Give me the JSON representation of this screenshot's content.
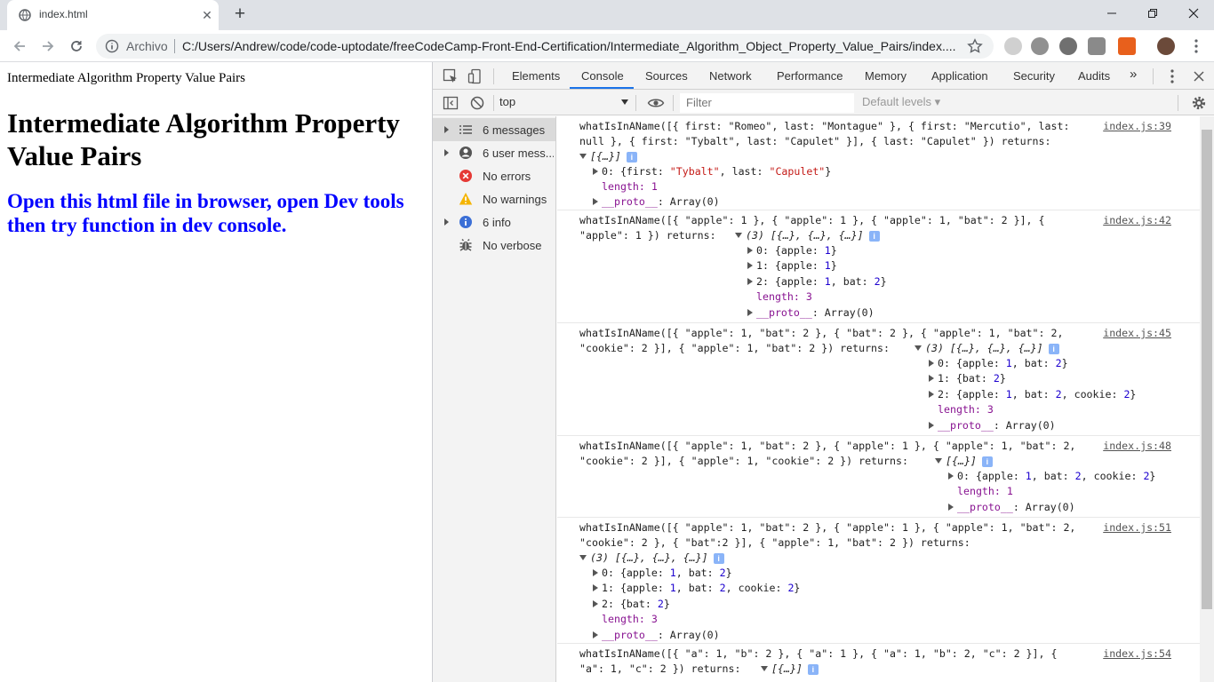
{
  "browser": {
    "tab_title": "index.html",
    "omnibox_label": "Archivo",
    "url": "C:/Users/Andrew/code/code-uptodate/freeCodeCamp-Front-End-Certification/Intermediate_Algorithm_Object_Property_Value_Pairs/index...."
  },
  "page": {
    "small_title": "Intermediate Algorithm Property Value Pairs",
    "heading": "Intermediate Algorithm Property Value Pairs",
    "subheading": "Open this html file in browser, open Dev tools then try function in dev console."
  },
  "devtools": {
    "tabs": [
      "Elements",
      "Console",
      "Sources",
      "Network",
      "Performance",
      "Memory",
      "Application",
      "Security",
      "Audits"
    ],
    "active_tab": "Console",
    "more_tabs": "»",
    "context": "top",
    "filter_placeholder": "Filter",
    "levels": "Default levels ▾",
    "sidebar": [
      {
        "label": "6 messages",
        "icon": "list-icon"
      },
      {
        "label": "6 user mess...",
        "icon": "user-icon"
      },
      {
        "label": "No errors",
        "icon": "error-icon"
      },
      {
        "label": "No warnings",
        "icon": "warning-icon"
      },
      {
        "label": "6 info",
        "icon": "info-icon"
      },
      {
        "label": "No verbose",
        "icon": "bug-icon"
      }
    ]
  },
  "console": {
    "messages": [
      {
        "source": "index.js:39",
        "call_l1": "whatIsInAName([{ first: \"Romeo\", last: \"Montague\" }, { first: \"Mercutio\", last:",
        "call_l2": "null }, { first: \"Tybalt\", last: \"Capulet\" }], { last: \"Capulet\" }) returns:",
        "summary": "[{…}]",
        "item0": "0: {first: \"Tybalt\", last: \"Capulet\"}",
        "length": "length: 1",
        "proto": "__proto__: Array(0)"
      },
      {
        "source": "index.js:42",
        "call_l1": "whatIsInAName([{ \"apple\": 1 }, { \"apple\": 1 }, { \"apple\": 1, \"bat\": 2 }], {",
        "call_l2": "\"apple\": 1 }) returns:",
        "summary": "(3) [{…}, {…}, {…}]",
        "item0": "0: {apple: 1}",
        "item1": "1: {apple: 1}",
        "item2": "2: {apple: 1, bat: 2}",
        "length": "length: 3",
        "proto": "__proto__: Array(0)"
      },
      {
        "source": "index.js:45",
        "call_l1": "whatIsInAName([{ \"apple\": 1, \"bat\": 2 }, { \"bat\": 2 }, { \"apple\": 1, \"bat\": 2,",
        "call_l2": "\"cookie\": 2 }], { \"apple\": 1, \"bat\": 2 }) returns:",
        "summary": "(3) [{…}, {…}, {…}]",
        "item0": "0: {apple: 1, bat: 2}",
        "item1": "1: {bat: 2}",
        "item2": "2: {apple: 1, bat: 2, cookie: 2}",
        "length": "length: 3",
        "proto": "__proto__: Array(0)"
      },
      {
        "source": "index.js:48",
        "call_l1": "whatIsInAName([{ \"apple\": 1, \"bat\": 2 }, { \"apple\": 1 }, { \"apple\": 1, \"bat\": 2,",
        "call_l2": "\"cookie\": 2 }], { \"apple\": 1, \"cookie\": 2 }) returns:",
        "summary": "[{…}]",
        "item0": "0: {apple: 1, bat: 2, cookie: 2}",
        "length": "length: 1",
        "proto": "__proto__: Array(0)"
      },
      {
        "source": "index.js:51",
        "call_l1": "whatIsInAName([{ \"apple\": 1, \"bat\": 2 }, { \"apple\": 1 }, { \"apple\": 1, \"bat\": 2,",
        "call_l2": "\"cookie\": 2 }, { \"bat\":2 }], { \"apple\": 1, \"bat\": 2 }) returns:",
        "summary": "(3) [{…}, {…}, {…}]",
        "item0": "0: {apple: 1, bat: 2}",
        "item1": "1: {apple: 1, bat: 2, cookie: 2}",
        "item2": "2: {bat: 2}",
        "length": "length: 3",
        "proto": "__proto__: Array(0)"
      },
      {
        "source": "index.js:54",
        "call_l1": "whatIsInAName([{ \"a\": 1, \"b\": 2 }, { \"a\": 1 }, { \"a\": 1, \"b\": 2, \"c\": 2 }], {",
        "call_l2": "\"a\": 1, \"c\": 2 }) returns:",
        "summary": "[{…}]"
      }
    ]
  },
  "colors": {
    "accent": "#1a73e8",
    "number": "#1c00cf",
    "string": "#c41a16",
    "property": "#881391",
    "page_blue": "#0000ff"
  }
}
